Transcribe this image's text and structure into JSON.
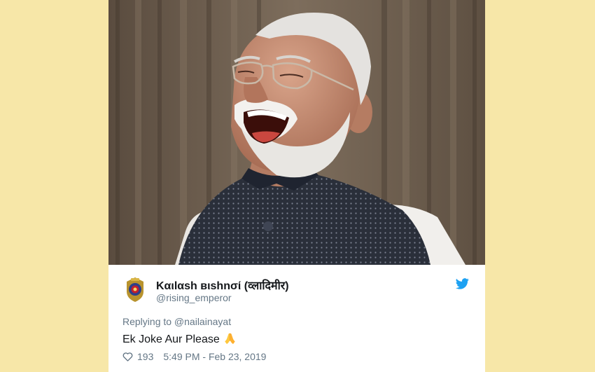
{
  "tweet": {
    "display_name": "Kαιlαsh вιshnσί (व्लादिमीर)",
    "handle": "@rising_emperor",
    "replying_to": "Replying to @nailainayat",
    "text": "Ek Joke Aur Please",
    "likes": "193",
    "time_date": "5:49 PM - Feb 23, 2019"
  },
  "icons": {
    "brand": "twitter-bird-icon",
    "like": "heart-icon",
    "emoji": "folded-hands-emoji"
  },
  "colors": {
    "background": "#f7e7a8",
    "twitter_blue": "#1da1f2",
    "text_primary": "#14171a",
    "text_secondary": "#657786"
  }
}
